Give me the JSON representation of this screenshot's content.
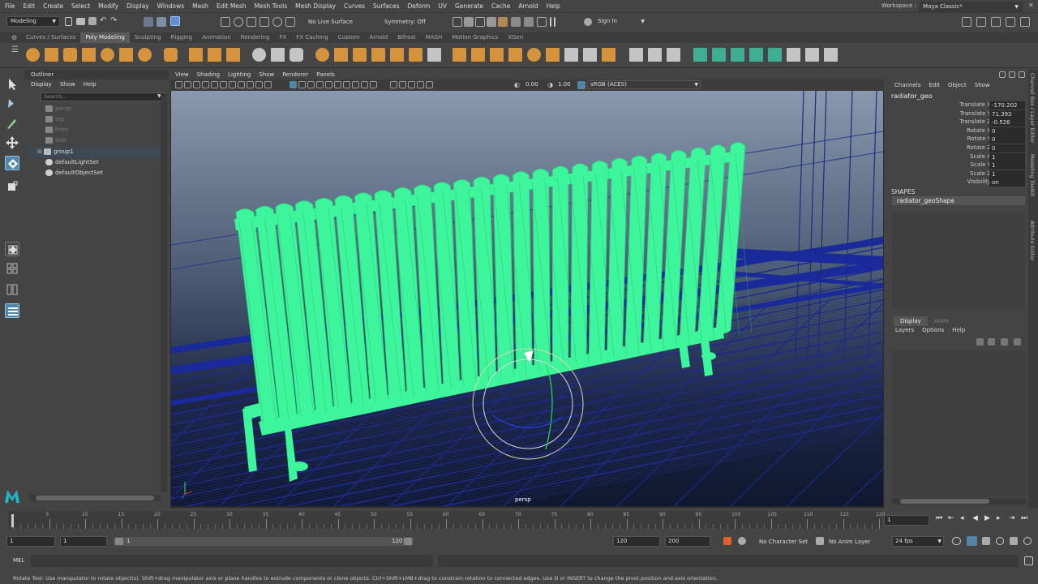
{
  "menubar": {
    "items": [
      "File",
      "Edit",
      "Create",
      "Select",
      "Modify",
      "Display",
      "Windows",
      "Mesh",
      "Edit Mesh",
      "Mesh Tools",
      "Mesh Display",
      "Curves",
      "Surfaces",
      "Deform",
      "UV",
      "Generate",
      "Cache",
      "Arnold",
      "Help"
    ],
    "workspace_label": "Workspace :",
    "workspace_value": "Maya Classic*"
  },
  "statusline": {
    "mode": "Modeling",
    "live_surface": "No Live Surface",
    "symmetry": "Symmetry: Off",
    "sign_in": "Sign In"
  },
  "shelf": {
    "tabs": [
      "Curves / Surfaces",
      "Poly Modeling",
      "Sculpting",
      "Rigging",
      "Animation",
      "Rendering",
      "FX",
      "FX Caching",
      "Custom",
      "Arnold",
      "Bifrost",
      "MASH",
      "Motion Graphics",
      "XGen"
    ],
    "active_tab": "Poly Modeling"
  },
  "outliner": {
    "title": "Outliner",
    "menu": [
      "Display",
      "Show",
      "Help"
    ],
    "search_placeholder": "Search...",
    "items": [
      {
        "label": "persp",
        "state": "dim"
      },
      {
        "label": "top",
        "state": "dim"
      },
      {
        "label": "front",
        "state": "dim"
      },
      {
        "label": "side",
        "state": "dim"
      },
      {
        "label": "group1",
        "state": "selected"
      },
      {
        "label": "defaultLightSet",
        "state": "normal"
      },
      {
        "label": "defaultObjectSet",
        "state": "normal"
      }
    ]
  },
  "viewport": {
    "menu": [
      "View",
      "Shading",
      "Lighting",
      "Show",
      "Renderer",
      "Panels"
    ],
    "exposure": "0.00",
    "gamma": "1.00",
    "colorspace": "sRGB (ACES)",
    "camera_label": "persp",
    "mesh_color": "#3df59a",
    "wire_color": "#1c2a8c"
  },
  "channelbox": {
    "menu": [
      "Channels",
      "Edit",
      "Object",
      "Show"
    ],
    "object": "radiator_geo",
    "attrs": [
      {
        "label": "Translate X",
        "value": "-170.202"
      },
      {
        "label": "Translate Y",
        "value": "71.393"
      },
      {
        "label": "Translate Z",
        "value": "-0.526"
      },
      {
        "label": "Rotate X",
        "value": "0"
      },
      {
        "label": "Rotate Y",
        "value": "0"
      },
      {
        "label": "Rotate Z",
        "value": "0"
      },
      {
        "label": "Scale X",
        "value": "1"
      },
      {
        "label": "Scale Y",
        "value": "1"
      },
      {
        "label": "Scale Z",
        "value": "1"
      },
      {
        "label": "Visibility",
        "value": "on"
      }
    ],
    "shapes_label": "SHAPES",
    "shape_name": "radiator_geoShape"
  },
  "sidetabs": [
    "Channel Box / Layer Editor",
    "Modeling Toolkit",
    "Attribute Editor"
  ],
  "layers": {
    "tabs": [
      "Display",
      "Anim"
    ],
    "menu": [
      "Layers",
      "Options",
      "Help"
    ]
  },
  "timeline": {
    "ticks": [
      "1",
      "5",
      "10",
      "15",
      "20",
      "25",
      "30",
      "35",
      "40",
      "45",
      "50",
      "55",
      "60",
      "65",
      "70",
      "75",
      "80",
      "85",
      "90",
      "95",
      "100",
      "105",
      "110",
      "115",
      "120"
    ],
    "current_frame": "1"
  },
  "range": {
    "start": "1",
    "playback_start": "1",
    "slider_start": "1",
    "slider_end": "120",
    "playback_end": "120",
    "end": "200",
    "character_set": "No Character Set",
    "anim_layer": "No Anim Layer",
    "fps": "24 fps"
  },
  "cmdline": {
    "label": "MEL"
  },
  "helpline": {
    "text": "Rotate Tool: Use manipulator to rotate object(s). Shift+drag manipulator axis or plane handles to extrude components or clone objects. Ctrl+Shift+LMB+drag to constrain rotation to connected edges. Use D or INSERT to change the pivot position and axis orientation."
  }
}
